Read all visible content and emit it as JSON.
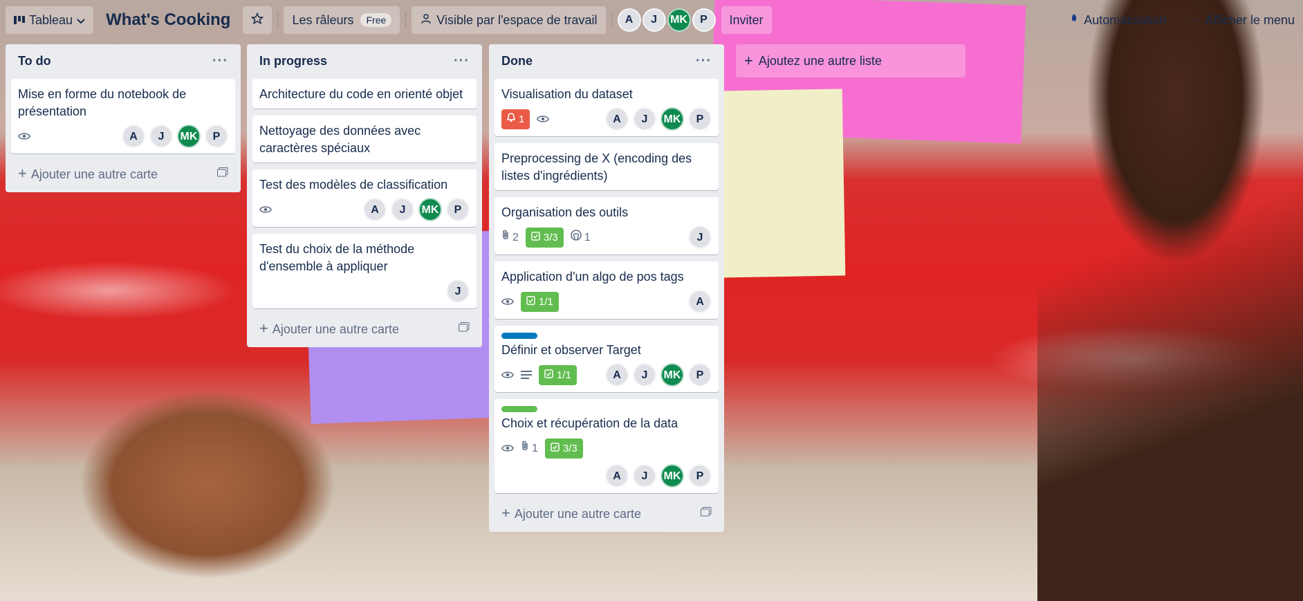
{
  "topbar": {
    "view_label": "Tableau",
    "board_title": "What's Cooking",
    "workspace_name": "Les râleurs",
    "workspace_plan": "Free",
    "visibility_label": "Visible par l'espace de travail",
    "members": [
      "A",
      "J",
      "MK",
      "P"
    ],
    "invite_label": "Inviter",
    "automation_label": "Automatisation",
    "menu_label": "Afficher le menu"
  },
  "colors": {
    "green_avatar": "#0f8b4f",
    "badge_green": "#61bd4f",
    "badge_red": "#eb5a46",
    "label_blue": "#0079bf",
    "label_green": "#61bd4f"
  },
  "add_card_label": "Ajouter une autre carte",
  "add_list_label": "Ajoutez une autre liste",
  "lists": [
    {
      "title": "To do",
      "cards": [
        {
          "title": "Mise en forme du notebook de présentation",
          "members": [
            "A",
            "J",
            "MK",
            "P"
          ]
        }
      ]
    },
    {
      "title": "In progress",
      "cards": [
        {
          "title": "Architecture du code en orienté objet"
        },
        {
          "title": "Nettoyage des données avec caractères spéciaux"
        },
        {
          "title": "Test des modèles de classification",
          "members": [
            "A",
            "J",
            "MK",
            "P"
          ]
        },
        {
          "title": "Test du choix de la méthode d'ensemble à appliquer",
          "members": [
            "J"
          ]
        }
      ]
    },
    {
      "title": "Done",
      "cards": [
        {
          "title": "Visualisation du dataset",
          "notifications": "1",
          "members": [
            "A",
            "J",
            "MK",
            "P"
          ]
        },
        {
          "title": "Preprocessing de X (encoding des listes d'ingrédients)"
        },
        {
          "title": "Organisation des outils",
          "attachments": "2",
          "checklist": "3/3",
          "github": "1",
          "members": [
            "J"
          ]
        },
        {
          "title": "Application d'un algo de pos tags",
          "checklist": "1/1",
          "members": [
            "A"
          ]
        },
        {
          "title": "Définir et observer Target",
          "checklist": "1/1",
          "members": [
            "A",
            "J",
            "MK",
            "P"
          ]
        },
        {
          "title": "Choix et récupération de la data",
          "attachments": "1",
          "checklist": "3/3",
          "members": [
            "A",
            "J",
            "MK",
            "P"
          ]
        }
      ]
    }
  ],
  "icons": {
    "board_view": "board-icon",
    "star": "star-icon",
    "visibility": "people-icon",
    "watch": "eye-icon",
    "description": "description-icon",
    "attachment": "paperclip-icon",
    "checklist": "checkbox-icon",
    "github": "github-icon",
    "notification": "bell-icon",
    "template": "card-template-icon"
  }
}
